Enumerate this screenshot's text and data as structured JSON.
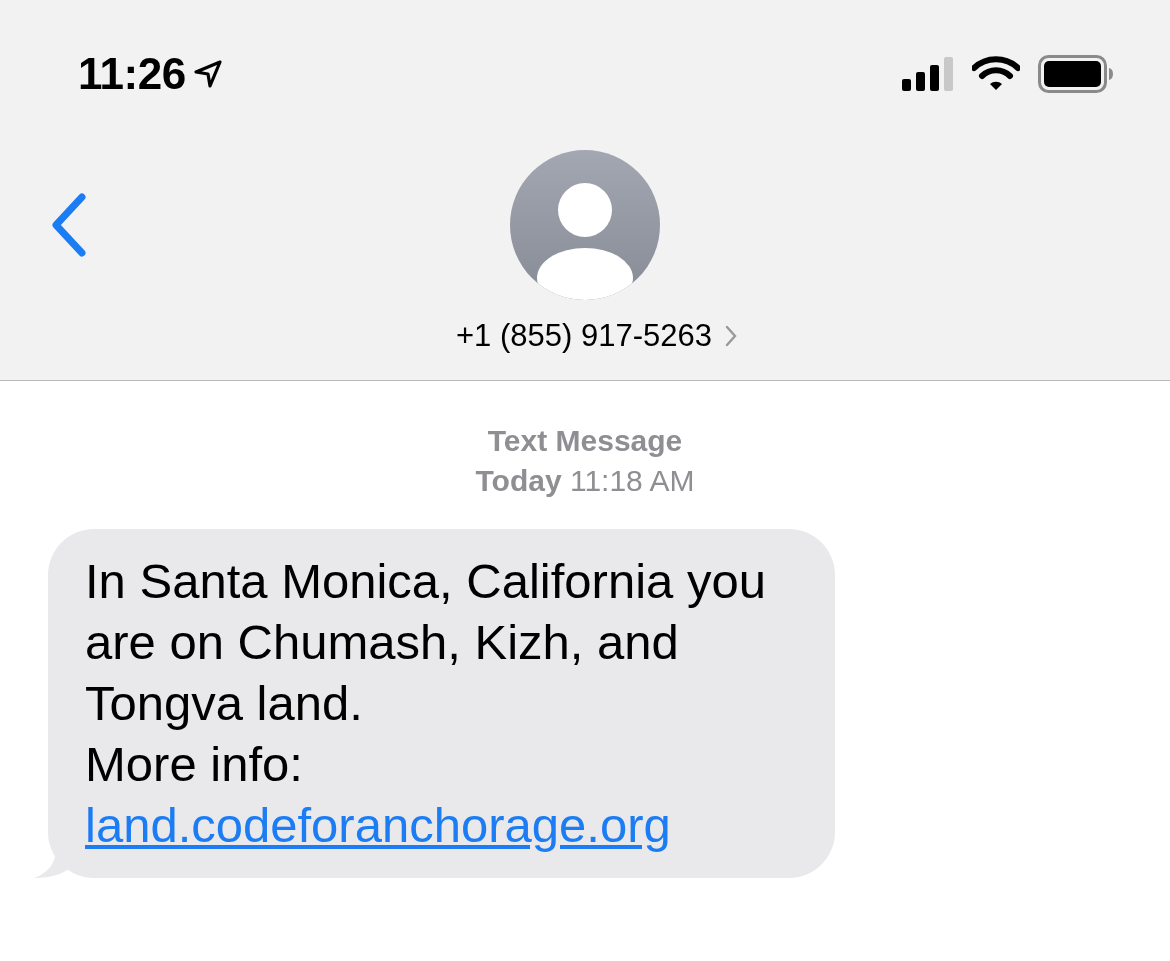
{
  "status_bar": {
    "time": "11:26",
    "location_active": true
  },
  "header": {
    "contact": "+1 (855) 917-5263"
  },
  "conversation": {
    "service": "Text Message",
    "timestamp": "**Today** 11:18 AM",
    "messages": [
      {
        "kind": "incoming",
        "text": "In Santa Monica, California you are on Chumash, Kizh, and Tongva land.",
        "more": "More info:",
        "link": "land.codeforanchorage.org"
      }
    ]
  }
}
